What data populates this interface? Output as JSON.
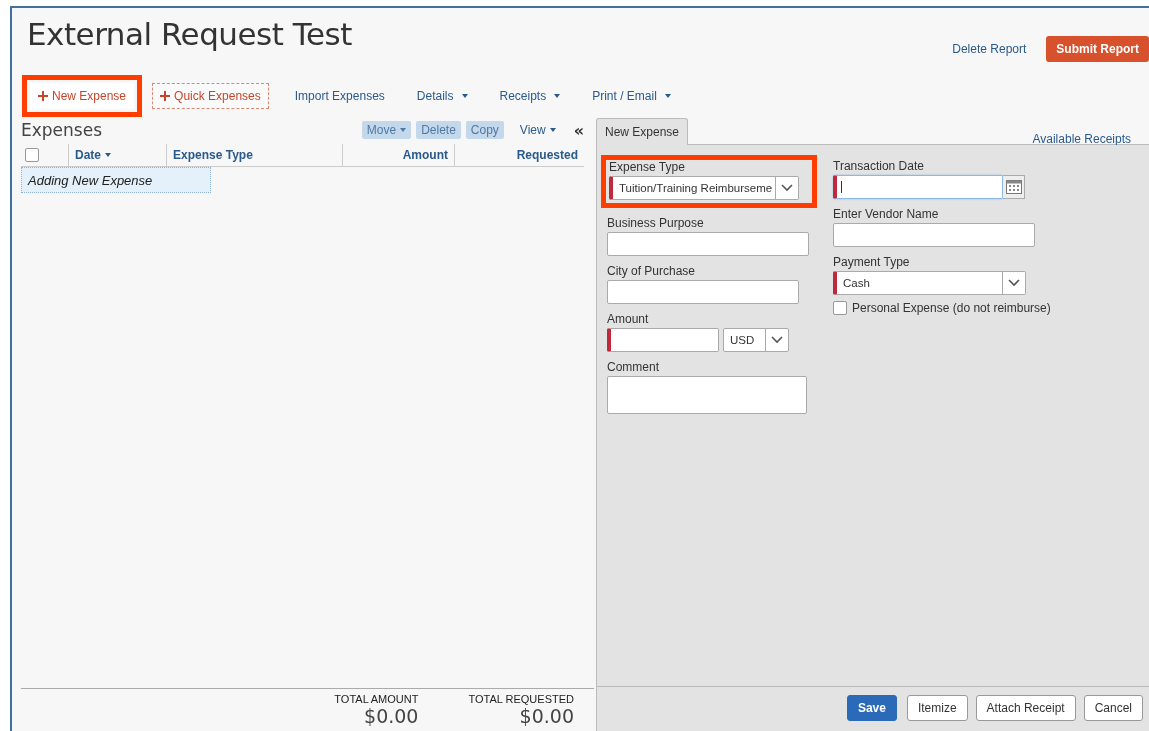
{
  "title": "External Request Test",
  "header_actions": [
    {
      "label": "Delete Report",
      "kind": "link"
    },
    {
      "label": "Submit Report",
      "kind": "primary"
    }
  ],
  "toolbar": [
    {
      "label": "New Expense",
      "kind": "add",
      "highlighted": true
    },
    {
      "label": "Quick Expenses",
      "kind": "add_dashed",
      "highlighted": false
    },
    {
      "label": "Import Expenses",
      "kind": "link",
      "highlighted": false
    },
    {
      "label": "Details",
      "kind": "menu",
      "highlighted": false
    },
    {
      "label": "Receipts",
      "kind": "menu",
      "highlighted": false
    },
    {
      "label": "Print / Email",
      "kind": "menu",
      "highlighted": false
    }
  ],
  "expenses": {
    "title": "Expenses",
    "actions": [
      {
        "label": "Move",
        "kind": "menu",
        "disabled": true
      },
      {
        "label": "Delete",
        "kind": "plain",
        "disabled": true
      },
      {
        "label": "Copy",
        "kind": "plain",
        "disabled": true
      },
      {
        "label": "View",
        "kind": "menu",
        "disabled": false
      },
      {
        "label": "«",
        "kind": "collapse"
      }
    ],
    "select_all": {
      "checked": false
    },
    "columns": [
      {
        "label": "Date",
        "kind": "sort"
      },
      {
        "label": "Expense Type",
        "kind": "text"
      },
      {
        "label": "Amount",
        "kind": "number"
      },
      {
        "label": "Requested",
        "kind": "number"
      }
    ],
    "rows": [
      {
        "label": "Adding New Expense",
        "selected": true
      }
    ],
    "totals": [
      {
        "label": "TOTAL AMOUNT",
        "value": "$0.00"
      },
      {
        "label": "TOTAL REQUESTED",
        "value": "$0.00"
      }
    ]
  },
  "form": {
    "tab": {
      "label": "New Expense",
      "selected": true
    },
    "link": "Available Receipts",
    "columns": [
      [
        {
          "label": "Expense Type",
          "kind": "select",
          "value": "Tuition/Training Reimburseme",
          "required": true,
          "highlighted": true
        },
        {
          "label": "Business Purpose",
          "kind": "text",
          "required": false
        },
        {
          "label": "City of Purchase",
          "kind": "text",
          "required": false
        },
        {
          "label": "Amount",
          "kind": "amount",
          "required": true,
          "currency": "USD"
        },
        {
          "label": "Comment",
          "kind": "textarea",
          "required": false
        }
      ],
      [
        {
          "label": "Transaction Date",
          "kind": "date",
          "required": true,
          "focused": true
        },
        {
          "label": "Enter Vendor Name",
          "kind": "text",
          "required": false
        },
        {
          "label": "Payment Type",
          "kind": "select",
          "value": "Cash",
          "required": true
        },
        {
          "label": "Personal Expense (do not reimburse)",
          "kind": "checkbox",
          "checked": false
        }
      ]
    ],
    "buttons": [
      {
        "label": "Save",
        "kind": "primary"
      },
      {
        "label": "Itemize",
        "kind": "plain"
      },
      {
        "label": "Attach Receipt",
        "kind": "plain"
      },
      {
        "label": "Cancel",
        "kind": "plain"
      }
    ]
  }
}
